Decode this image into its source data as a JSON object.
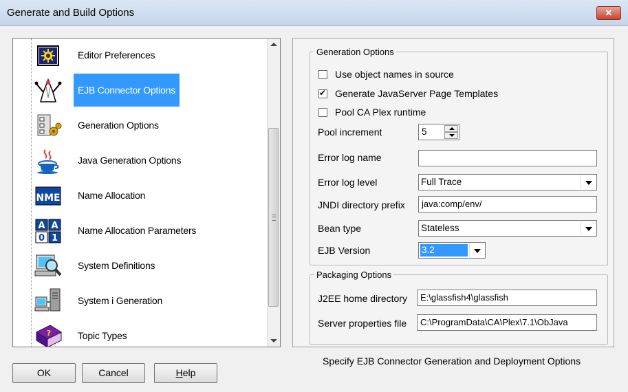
{
  "window": {
    "title": "Generate and Build Options",
    "close_glyph": "✕"
  },
  "nav": {
    "items": [
      {
        "label": "Editor Preferences",
        "icon": "editor-preferences-icon"
      },
      {
        "label": "EJB Connector Options",
        "icon": "ejb-connector-icon",
        "selected": true
      },
      {
        "label": "Generation Options",
        "icon": "generation-options-icon"
      },
      {
        "label": "Java Generation Options",
        "icon": "java-icon"
      },
      {
        "label": "Name Allocation",
        "icon": "nme-icon",
        "icon_text": "NME"
      },
      {
        "label": "Name Allocation Parameters",
        "icon": "aa01-grid-icon",
        "icon_text": [
          "A",
          "A",
          "0",
          "1"
        ]
      },
      {
        "label": "System Definitions",
        "icon": "magnifier-computer-icon"
      },
      {
        "label": "System i Generation",
        "icon": "server-computer-icon"
      },
      {
        "label": "Topic Types",
        "icon": "help-book-icon",
        "icon_text": "?"
      }
    ]
  },
  "generation": {
    "legend": "Generation Options",
    "use_object_names": {
      "label": "Use object names in source",
      "checked": false
    },
    "generate_jsp": {
      "label": "Generate JavaServer Page Templates",
      "checked": true
    },
    "pool_runtime": {
      "label": "Pool CA Plex runtime",
      "checked": false
    },
    "pool_increment": {
      "label": "Pool increment",
      "value": "5"
    },
    "error_log_name": {
      "label": "Error log name",
      "value": ""
    },
    "error_log_level": {
      "label": "Error log level",
      "value": "Full Trace"
    },
    "jndi_prefix": {
      "label": "JNDI directory prefix",
      "value": "java:comp/env/"
    },
    "bean_type": {
      "label": "Bean type",
      "value": "Stateless"
    },
    "ejb_version": {
      "label": "EJB Version",
      "value": "3.2"
    }
  },
  "packaging": {
    "legend": "Packaging Options",
    "j2ee_home": {
      "label": "J2EE home directory",
      "value": "E:\\glassfish4\\glassfish"
    },
    "server_props": {
      "label": "Server properties file",
      "value": "C:\\ProgramData\\CA\\Plex\\7.1\\ObJava"
    }
  },
  "buttons": {
    "ok": "OK",
    "cancel": "Cancel",
    "help_first": "H",
    "help_rest": "elp"
  },
  "status_text": "Specify EJB Connector Generation and Deployment Options"
}
